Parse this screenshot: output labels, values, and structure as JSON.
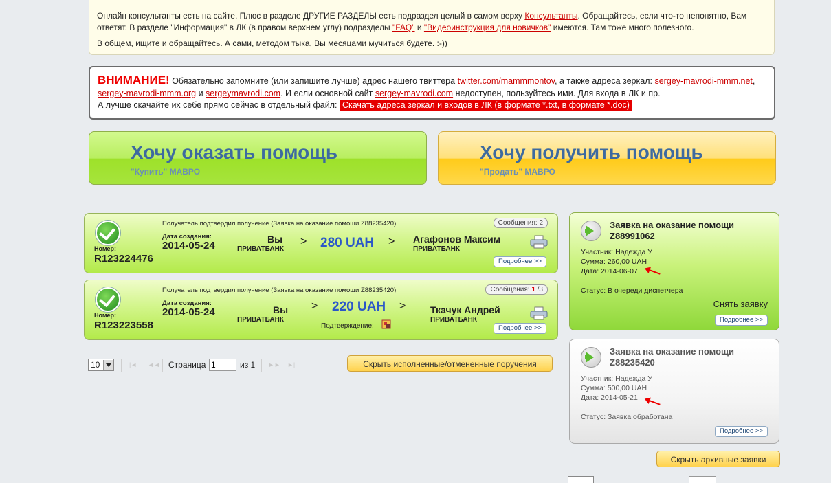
{
  "info": {
    "line1_prefix": "Онлайн консультанты есть на сайте, Плюс в разделе ДРУГИЕ РАЗДЕЛЫ есть подраздел целый в самом верху ",
    "line1_link": "Консультанты",
    "line1_suffix": ". Обращайтесь, если что-то непонятно, Вам",
    "line2_prefix": "ответят. В разделе \"Информация\" в ЛК (в правом верхнем углу) подразделы ",
    "line2_faq": "\"FAQ\"",
    "line2_and": " и ",
    "line2_video": "\"Видеоинструкция для новичков\"",
    "line2_suffix": " имеются. Там тоже много полезного.",
    "line3": "В общем, ищите и обращайтесь. А сами, методом тыка, Вы месяцами мучиться будете. :-))"
  },
  "attention": {
    "warn": "ВНИМАНИЕ!",
    "t1": " Обязательно запомните (или запишите лучше) адрес нашего твиттера ",
    "twitter": "twitter.com/mammmontov",
    "t2": ", а также адреса зеркал: ",
    "mirror1": "sergey-mavrodi-mmm.net",
    "t3": ", ",
    "mirror2": "sergey-mavrodi-mmm.org",
    "t4": " и ",
    "mirror3": "sergeymavrodi.com",
    "t5": ". И если основной сайт ",
    "main": "sergey-mavrodi.com",
    "t6": " недоступен, пользуйтесь ими. Для входа в ЛК и пр.",
    "t7": "А лучше скачайте их себе прямо сейчас в отдельный файл: ",
    "dl_text": "Скачать адреса зеркал и входов в ЛК (",
    "dl_txt": "в формате *.txt",
    "dl_sep": ", ",
    "dl_doc": "в формате *.doc",
    "dl_end": ")"
  },
  "big_buttons": {
    "help_title": "Хочу оказать помощь",
    "help_sub": "\"Купить\" МАВРО",
    "get_title": "Хочу получить помощь",
    "get_sub": "\"Продать\" МАВРО"
  },
  "orders": [
    {
      "status": "Получатель подтвердил получение (Заявка на оказание помощи Z88235420)",
      "msgs_label": "Сообщения:",
      "msgs_count": "2",
      "num_label": "Номер:",
      "number": "R123224476",
      "date_label": "Дата создания:",
      "date": "2014-05-24",
      "from": "Вы",
      "from_bank": "ПРИВАТБАНК",
      "amount": "280 UAH",
      "to": "Агафонов Максим",
      "to_bank": "ПРИВАТБАНК",
      "more": "Подробнее >>"
    },
    {
      "status": "Получатель подтвердил получение (Заявка на оказание помощи Z88235420)",
      "msgs_label": "Сообщения:",
      "msgs_new": "1",
      "msgs_total": "/3",
      "num_label": "Номер:",
      "number": "R123223558",
      "date_label": "Дата создания:",
      "date": "2014-05-24",
      "from": "Вы",
      "from_bank": "ПРИВАТБАНК",
      "amount": "220 UAH",
      "to": "Ткачук Андрей",
      "to_bank": "ПРИВАТБАНК",
      "confirm": "Подтверждение:",
      "more": "Подробнее >>"
    }
  ],
  "pager": {
    "per_page": "10",
    "page_label": "Страница",
    "page_value": "1",
    "of": "из 1",
    "first": "|◄",
    "prev": "◄◄",
    "next": "►►",
    "last": "►|"
  },
  "hide_done": "Скрыть исполненные/отмененные поручения",
  "requests": [
    {
      "title": "Заявка на оказание помощи Z88991062",
      "participant": "Участник: Надежда У",
      "sum": "Сумма: 260,00 UAH",
      "date": "Дата: 2014-06-07",
      "status": "Статус: В очереди диспетчера",
      "cancel": "Снять заявку",
      "more": "Подробнее >>"
    },
    {
      "title": "Заявка на оказание помощи Z88235420",
      "participant": "Участник: Надежда У",
      "sum": "Сумма: 500,00 UAH",
      "date": "Дата: 2014-05-21",
      "status": "Статус: Заявка обработана",
      "more": "Подробнее >>"
    }
  ],
  "hide_archive": "Скрыть архивные заявки",
  "colors": {
    "green": "#b3ea4a",
    "orange": "#ffcb1a",
    "amount_blue": "#2a57c8",
    "warn_red": "#e00000"
  }
}
